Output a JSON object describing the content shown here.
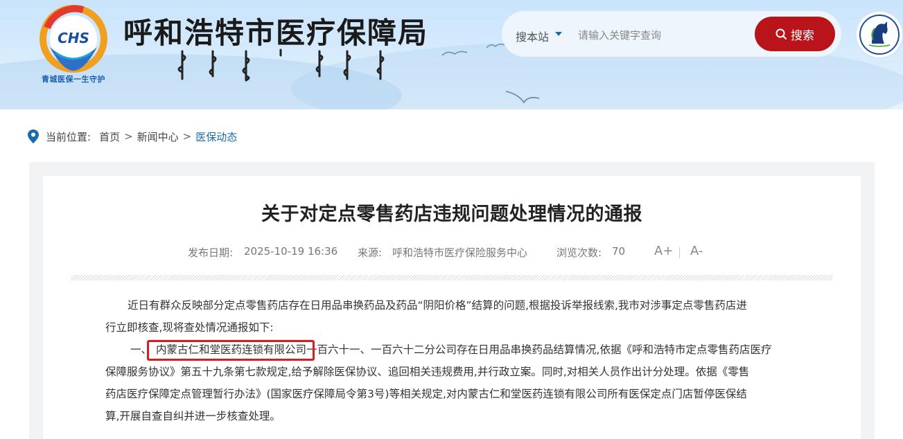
{
  "header": {
    "site_title": "呼和浩特市医疗保障局",
    "logo_text": "CHS",
    "logo_slogan": "青城医保一生守护",
    "search": {
      "scope": "搜本站",
      "placeholder": "请输入关键字查询",
      "button_label": "搜索"
    },
    "colors": {
      "brand_red": "#b8141a",
      "banner_blue": "#c9e4fb"
    }
  },
  "breadcrumb": {
    "label": "当前位置:",
    "items": [
      "首页",
      "新闻中心",
      "医保动态"
    ],
    "separator": ">"
  },
  "article": {
    "title": "关于对定点零售药店违规问题处理情况的通报",
    "meta": {
      "date_label": "发布日期:",
      "date": "2025-10-19 16:36",
      "source_label": "来源:",
      "source": "呼和浩特市医疗保险服务中心",
      "views_label": "浏览次数:",
      "views": "70",
      "font_increase": "A+",
      "font_decrease": "A-"
    },
    "paragraphs": {
      "p1_line1": "近日有群众反映部分定点零售药店存在日用品串换药品及药品“阴阳价格”结算的问题,根据投诉举报线索,我市对涉事定点零售药店进",
      "p1_line2": "行立即核查,现将查处情况通报如下:",
      "p2_prefix": "一、",
      "p2_company": "内蒙古仁和堂医药连锁有限公司",
      "p2_rest1": "一百六十一、一百六十二分公司存在日用品串换药品结算情况,依据《呼和浩特市定点零售药店医疗",
      "p2_line2": "保障服务协议》第五十九条第七款规定,给予解除医保协议、追回相关违规费用,并行政立案。同时,对相关人员作出计分处理。依据《零售",
      "p2_line3": "药店医疗保障定点管理暂行办法》(国家医疗保障局令第3号)等相关规定,对内蒙古仁和堂医药连锁有限公司所有医保定点门店暂停医保结",
      "p2_line4": "算,开展自查自纠并进一步核查处理。"
    },
    "highlight_color": "#e0191e"
  }
}
